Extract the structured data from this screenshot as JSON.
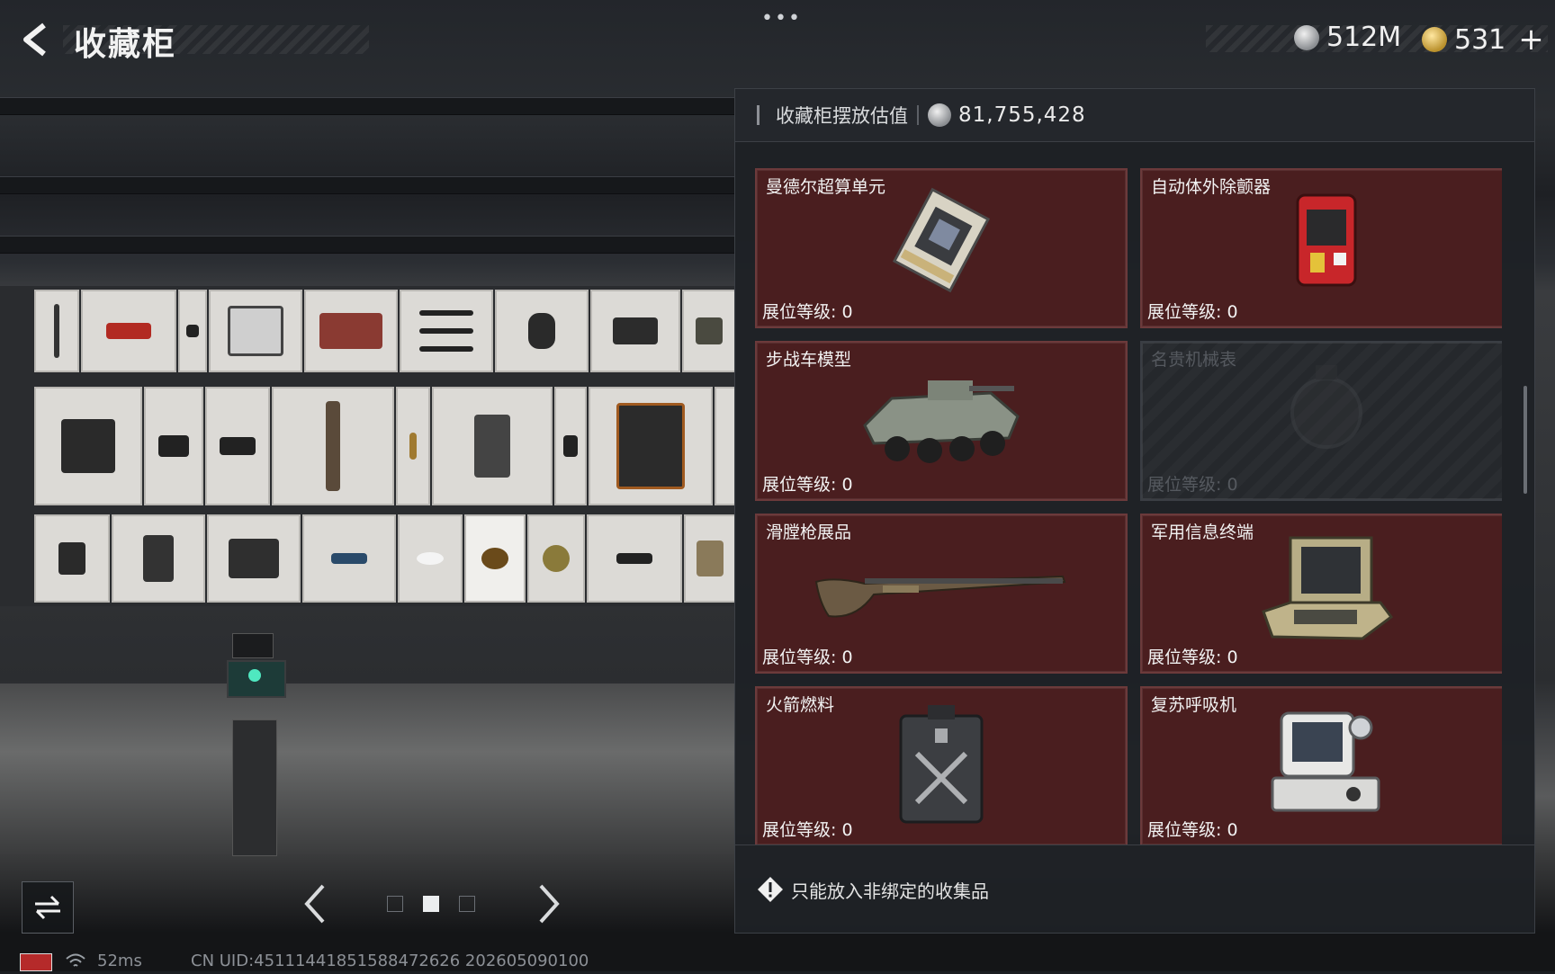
{
  "header": {
    "title": "收藏柜",
    "back_icon": "back-arrow-icon",
    "more_icon": "more-dots-icon",
    "currency": [
      {
        "icon": "silver-coin-icon",
        "value": "512M"
      },
      {
        "icon": "gold-coin-icon",
        "value": "531",
        "action": "+"
      }
    ]
  },
  "panel": {
    "estimate_label": "收藏柜摆放估值",
    "estimate_value": "81,755,428",
    "items": [
      {
        "name": "曼德尔超算单元",
        "level_label": "展位等级:",
        "level": "0",
        "locked": false,
        "icon": "supercomputer-chip-icon"
      },
      {
        "name": "自动体外除颤器",
        "level_label": "展位等级:",
        "level": "0",
        "locked": false,
        "icon": "defibrillator-icon"
      },
      {
        "name": "步战车模型",
        "level_label": "展位等级:",
        "level": "0",
        "locked": false,
        "icon": "ifv-model-icon"
      },
      {
        "name": "名贵机械表",
        "level_label": "展位等级:",
        "level": "0",
        "locked": true,
        "icon": "mechanical-watch-icon"
      },
      {
        "name": "滑膛枪展品",
        "level_label": "展位等级:",
        "level": "0",
        "locked": false,
        "icon": "musket-icon"
      },
      {
        "name": "军用信息终端",
        "level_label": "展位等级:",
        "level": "0",
        "locked": false,
        "icon": "military-terminal-icon"
      },
      {
        "name": "火箭燃料",
        "level_label": "展位等级:",
        "level": "0",
        "locked": false,
        "icon": "rocket-fuel-can-icon"
      },
      {
        "name": "复苏呼吸机",
        "level_label": "展位等级:",
        "level": "0",
        "locked": false,
        "icon": "ventilator-icon"
      }
    ],
    "footer_note": "只能放入非绑定的收集品"
  },
  "bottom": {
    "swap_icon": "swap-arrows-icon",
    "pages": 3,
    "current_page": 2
  },
  "status": {
    "ping": "52ms",
    "uid": "CN UID:4511144185158847262​6 20260509010​0"
  },
  "colors": {
    "card_bg": "#4a1e1f",
    "card_border": "#6c3a3b",
    "panel_bg": "#1e2125"
  }
}
